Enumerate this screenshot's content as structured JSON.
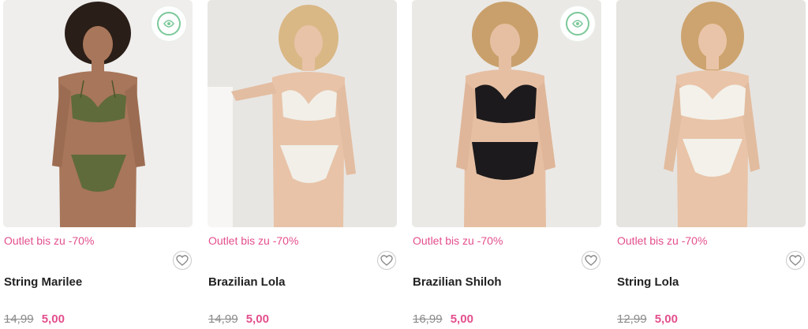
{
  "products": [
    {
      "promo": "Outlet bis zu -70%",
      "name": "String Marilee",
      "old_price": "14,99",
      "new_price": "5,00",
      "lingerie_color": "#5f6b3a",
      "sustainable_badge": true,
      "image": "model in green lace bra and string"
    },
    {
      "promo": "Outlet bis zu -70%",
      "name": "Brazilian Lola",
      "old_price": "14,99",
      "new_price": "5,00",
      "lingerie_color": "#f1efe8",
      "sustainable_badge": false,
      "image": "model in ivory bra and brazilian"
    },
    {
      "promo": "Outlet bis zu -70%",
      "name": "Brazilian Shiloh",
      "old_price": "16,99",
      "new_price": "5,00",
      "lingerie_color": "#1c1a1c",
      "sustainable_badge": true,
      "image": "model in black lace bra and brazilian"
    },
    {
      "promo": "Outlet bis zu -70%",
      "name": "String Lola",
      "old_price": "12,99",
      "new_price": "5,00",
      "lingerie_color": "#f3f1ea",
      "sustainable_badge": false,
      "image": "model in ivory bra and string"
    }
  ],
  "icons": {
    "wishlist": "heart-icon",
    "badge": "sustainable-badge-icon"
  },
  "colors": {
    "accent": "#e34f8d",
    "old_price": "#8b8b8b",
    "text": "#222222"
  }
}
